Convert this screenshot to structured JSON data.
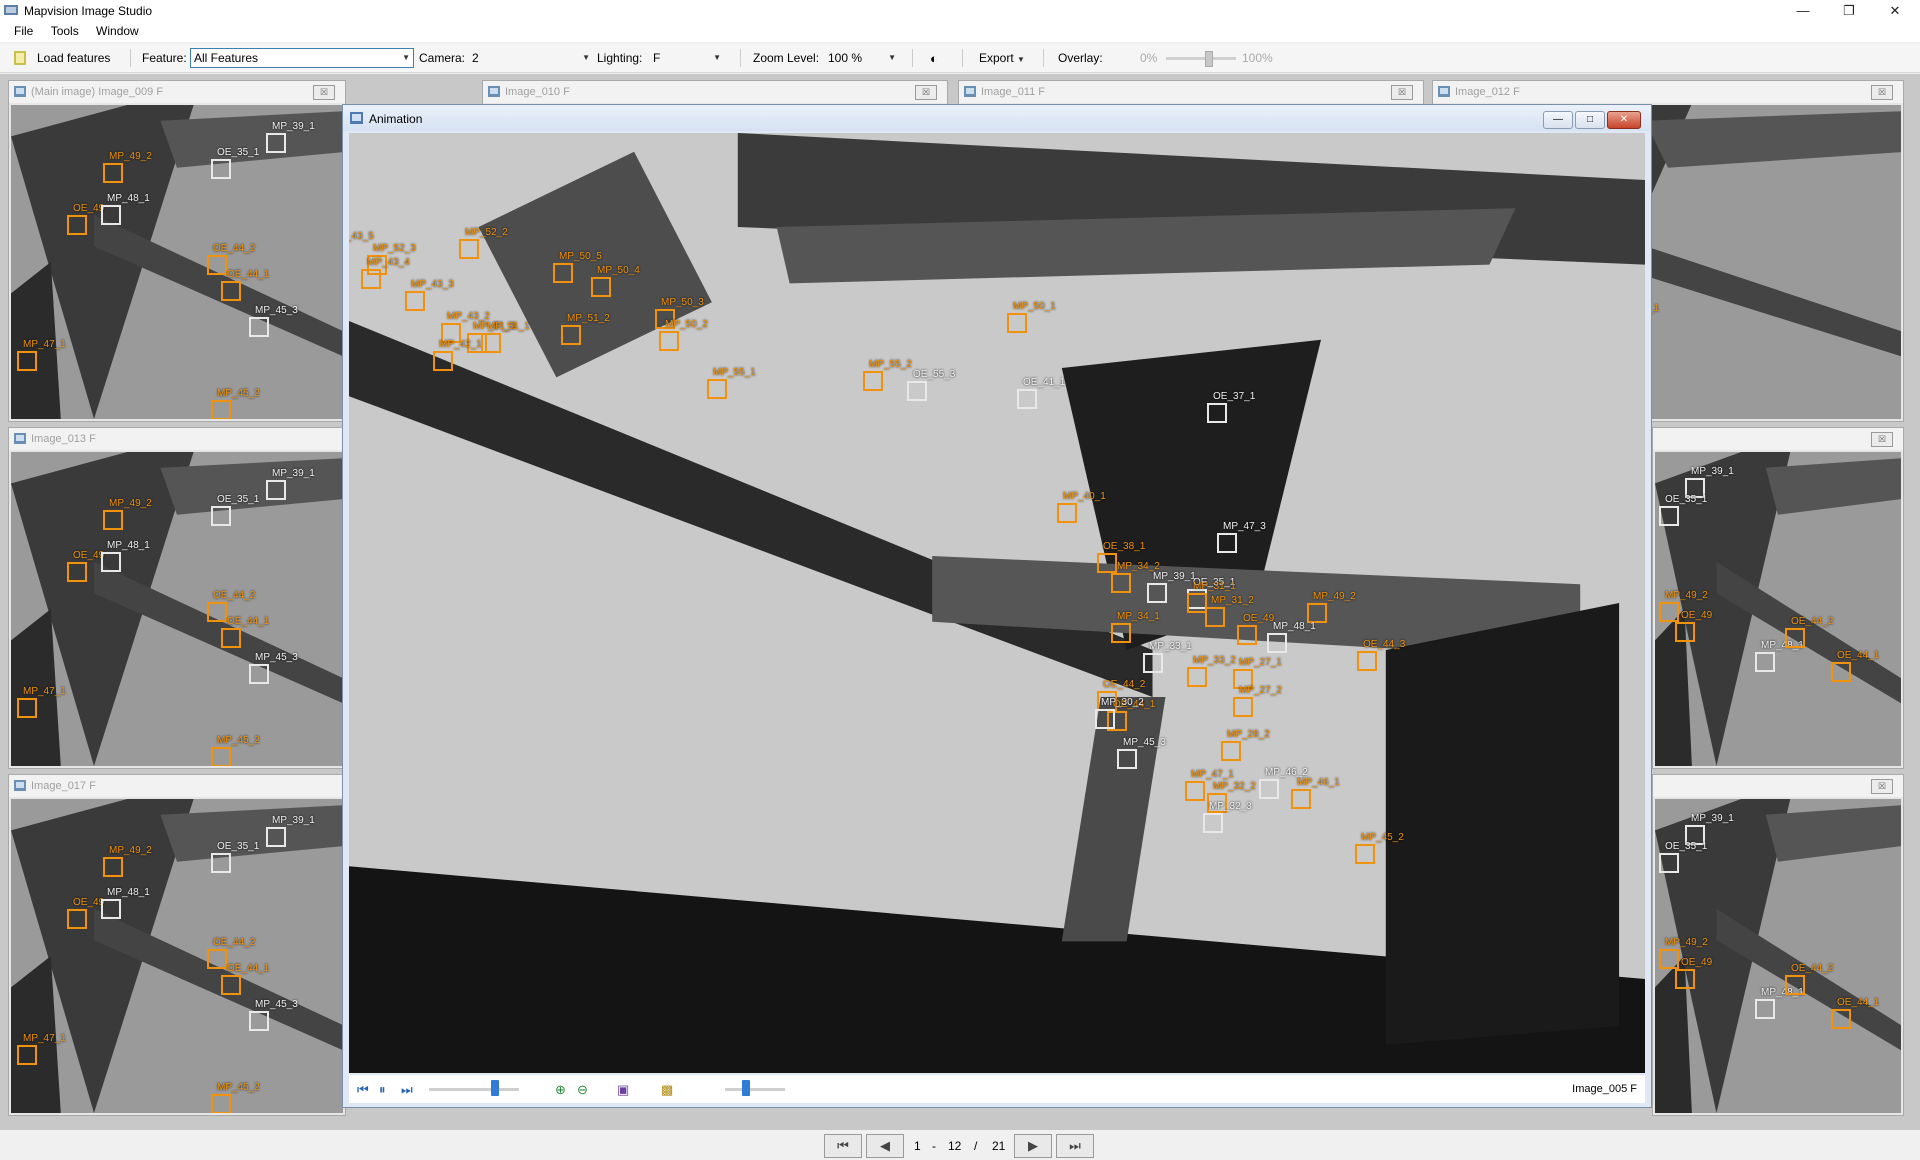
{
  "window": {
    "title": "Mapvision Image Studio"
  },
  "menu": [
    "File",
    "Tools",
    "Window"
  ],
  "toolbar": {
    "load_features": "Load features",
    "feature_label": "Feature:",
    "feature_value": "All Features",
    "camera_label": "Camera:",
    "camera_value": "2",
    "lighting_label": "Lighting:",
    "lighting_value": "F",
    "zoom_label": "Zoom Level:",
    "zoom_value": "100 %",
    "export_label": "Export",
    "overlay_label": "Overlay:",
    "overlay_min": "0%",
    "overlay_max": "100%",
    "overlay_value": 0.6
  },
  "tiles": {
    "main": "(Main image) Image_009 F",
    "image_010": "Image_010 F",
    "image_011": "Image_011 F",
    "image_012": "Image_012 F",
    "image_013": "Image_013 F",
    "image_017": "Image_017 F"
  },
  "tile_markers": [
    {
      "label": "MP_39_1",
      "white": true
    },
    {
      "label": "OE_35_1",
      "white": true
    },
    {
      "label": "MP_49_2",
      "white": false
    },
    {
      "label": "OE_49",
      "white": false
    },
    {
      "label": "MP_48_1",
      "white": true
    },
    {
      "label": "OE_44_2",
      "white": false
    },
    {
      "label": "OE_44_1",
      "white": false
    },
    {
      "label": "MP_45_3",
      "white": true
    },
    {
      "label": "MP_47_1",
      "white": false
    },
    {
      "label": "MP_45_2",
      "white": false
    }
  ],
  "animation": {
    "title": "Animation",
    "current_image": "Image_005 F",
    "speed_value": 0.73,
    "frame_value": 0.35,
    "markers": [
      {
        "label": "MP_56_1",
        "white": false
      },
      {
        "label": "OE_56_2",
        "white": false
      },
      {
        "label": "MP_53_1",
        "white": true
      },
      {
        "label": "MP_43_5",
        "white": false
      },
      {
        "label": "MP_52_3",
        "white": false
      },
      {
        "label": "MP_43_4",
        "white": false
      },
      {
        "label": "MP_43_3",
        "white": false
      },
      {
        "label": "MP_52_2",
        "white": false
      },
      {
        "label": "MP_50_5",
        "white": false
      },
      {
        "label": "MP_50_4",
        "white": false
      },
      {
        "label": "MP_43_2",
        "white": false
      },
      {
        "label": "MP_51_3",
        "white": false
      },
      {
        "label": "MP_42_1",
        "white": false
      },
      {
        "label": "MP_51_1",
        "white": false
      },
      {
        "label": "MP_51_2",
        "white": false
      },
      {
        "label": "MP_50_3",
        "white": false
      },
      {
        "label": "MP_50_2",
        "white": false
      },
      {
        "label": "MP_50_1",
        "white": false
      },
      {
        "label": "OE_55_3",
        "white": true
      },
      {
        "label": "MP_55_1",
        "white": false
      },
      {
        "label": "MP_55_2",
        "white": false
      },
      {
        "label": "OE_41_1",
        "white": true
      },
      {
        "label": "OE_37_1",
        "white": true
      },
      {
        "label": "MP_47_3",
        "white": true
      },
      {
        "label": "MP_40_1",
        "white": false
      },
      {
        "label": "OE_38_1",
        "white": false
      },
      {
        "label": "MP_39_1",
        "white": true
      },
      {
        "label": "OE_35_1",
        "white": true
      },
      {
        "label": "MP_49_2",
        "white": false
      },
      {
        "label": "OE_49",
        "white": false
      },
      {
        "label": "MP_48_1",
        "white": true
      },
      {
        "label": "OE_44_3",
        "white": false
      },
      {
        "label": "OE_44_2",
        "white": false
      },
      {
        "label": "OE_44_1",
        "white": false
      },
      {
        "label": "MP_45_3",
        "white": true
      },
      {
        "label": "MP_47_1",
        "white": false
      },
      {
        "label": "MP_45_2",
        "white": false
      },
      {
        "label": "MP_46_2",
        "white": true
      },
      {
        "label": "MP_46_1",
        "white": false
      },
      {
        "label": "MP_34_2",
        "white": false
      },
      {
        "label": "MP_31_1",
        "white": false
      },
      {
        "label": "MP_31_2",
        "white": false
      },
      {
        "label": "MP_34_1",
        "white": false
      },
      {
        "label": "MP_33_1",
        "white": true
      },
      {
        "label": "MP_33_2",
        "white": false
      },
      {
        "label": "MP_27_1",
        "white": false
      },
      {
        "label": "MP_30_2",
        "white": true
      },
      {
        "label": "MP_27_2",
        "white": false
      },
      {
        "label": "MP_28_2",
        "white": false
      },
      {
        "label": "MP_32_2",
        "white": false
      },
      {
        "label": "MP_32_3",
        "white": true
      }
    ]
  },
  "pager": {
    "current": "12",
    "separator": "/",
    "total": "21",
    "range_start": "1",
    "range_dash": "-"
  }
}
